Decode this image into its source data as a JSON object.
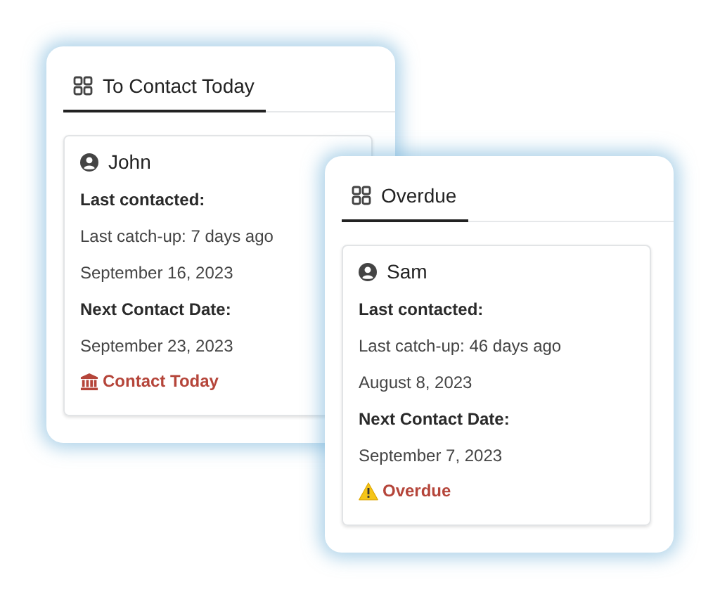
{
  "panels": [
    {
      "tab": {
        "label": "To Contact Today",
        "selected": true
      },
      "contact": {
        "name": "John",
        "last_label": "Last contacted:",
        "last_catchup": "Last catch-up: 7 days ago",
        "last_date": "September 16, 2023",
        "next_label": "Next Contact Date:",
        "next_date": "September 23, 2023",
        "status": {
          "kind": "today",
          "label": "Contact Today"
        }
      }
    },
    {
      "tab": {
        "label": "Overdue",
        "selected": true
      },
      "contact": {
        "name": "Sam",
        "last_label": "Last contacted:",
        "last_catchup": "Last catch-up: 46 days ago",
        "last_date": "August 8, 2023",
        "next_label": "Next Contact Date:",
        "next_date": "September 7, 2023",
        "status": {
          "kind": "overdue",
          "label": "Overdue"
        }
      }
    }
  ]
}
